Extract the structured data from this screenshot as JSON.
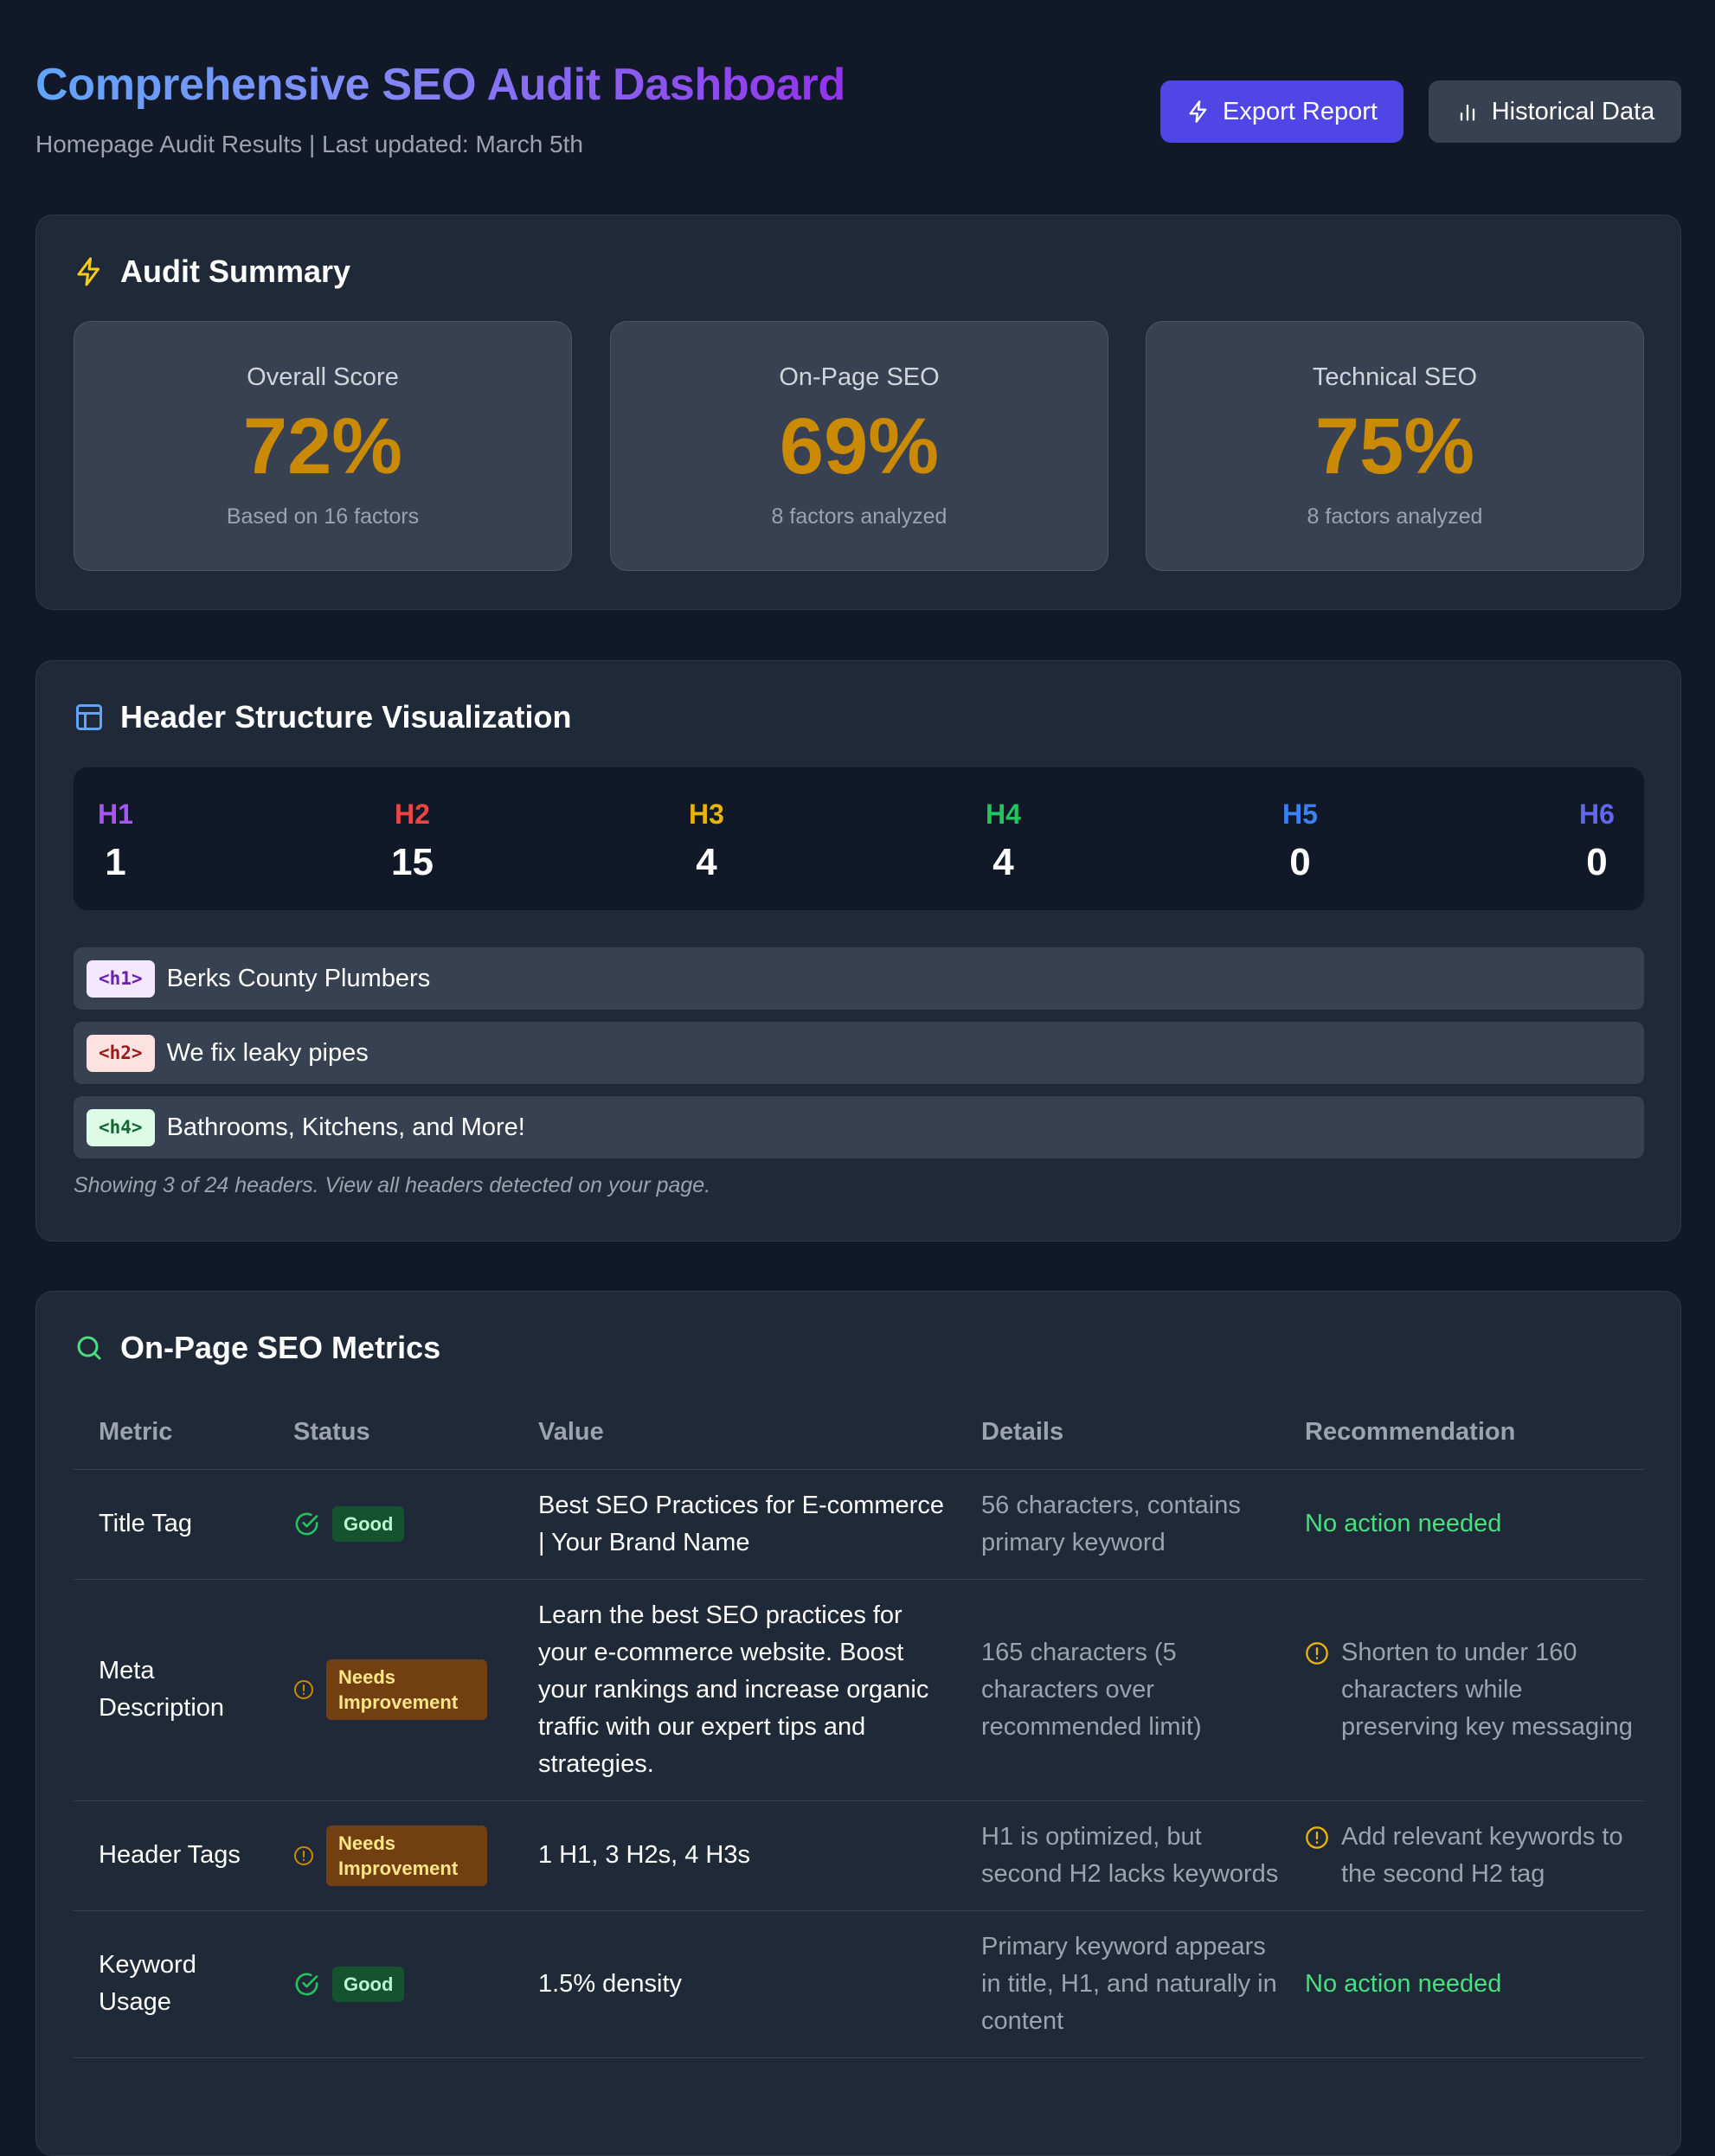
{
  "header": {
    "title": "Comprehensive SEO Audit Dashboard",
    "subtitle": "Homepage Audit Results | Last updated: March 5th",
    "buttons": {
      "export": {
        "label": "Export Report",
        "icon": "lightning-icon"
      },
      "history": {
        "label": "Historical Data",
        "icon": "bar-chart-icon"
      }
    }
  },
  "summary": {
    "title": "Audit Summary",
    "icon": "lightning-icon",
    "scores": [
      {
        "label": "Overall Score",
        "value": "72%",
        "sub": "Based on 16 factors"
      },
      {
        "label": "On-Page SEO",
        "value": "69%",
        "sub": "8 factors analyzed"
      },
      {
        "label": "Technical SEO",
        "value": "75%",
        "sub": "8 factors analyzed"
      }
    ]
  },
  "header_structure": {
    "title": "Header Structure Visualization",
    "icon": "layout-icon",
    "counts": [
      {
        "level": "H1",
        "count": "1",
        "color": "#a855f7"
      },
      {
        "level": "H2",
        "count": "15",
        "color": "#ef4444"
      },
      {
        "level": "H3",
        "count": "4",
        "color": "#eab308"
      },
      {
        "level": "H4",
        "count": "4",
        "color": "#22c55e"
      },
      {
        "level": "H5",
        "count": "0",
        "color": "#3b82f6"
      },
      {
        "level": "H6",
        "count": "0",
        "color": "#6366f1"
      }
    ],
    "headers": [
      {
        "tag": "<h1>",
        "text": "Berks County Plumbers",
        "tag_bg": "#f3e8ff",
        "tag_color": "#6b21a8"
      },
      {
        "tag": "<h2>",
        "text": "We fix leaky pipes",
        "tag_bg": "#fee2e2",
        "tag_color": "#991b1b"
      },
      {
        "tag": "<h4>",
        "text": "Bathrooms, Kitchens, and More!",
        "tag_bg": "#dcfce7",
        "tag_color": "#166534"
      }
    ],
    "note": "Showing 3 of 24 headers. View all headers detected on your page."
  },
  "metrics": {
    "title": "On-Page SEO Metrics",
    "icon": "search-icon",
    "columns": [
      "Metric",
      "Status",
      "Value",
      "Details",
      "Recommendation"
    ],
    "rows": [
      {
        "metric": "Title Tag",
        "status": "Good",
        "status_type": "good",
        "value": "Best SEO Practices for E-commerce | Your Brand Name",
        "details": "56 characters, contains primary keyword",
        "recommendation": "No action needed"
      },
      {
        "metric": "Meta Description",
        "status": "Needs Improvement",
        "status_type": "warn",
        "value": "Learn the best SEO practices for your e-commerce website. Boost your rankings and increase organic traffic with our expert tips and strategies.",
        "details": "165 characters (5 characters over recommended limit)",
        "recommendation": "Shorten to under 160 characters while preserving key messaging"
      },
      {
        "metric": "Header Tags",
        "status": "Needs Improvement",
        "status_type": "warn",
        "value": "1 H1, 3 H2s, 4 H3s",
        "details": "H1 is optimized, but second H2 lacks keywords",
        "recommendation": "Add relevant keywords to the second H2 tag"
      },
      {
        "metric": "Keyword Usage",
        "status": "Good",
        "status_type": "good",
        "value": "1.5% density",
        "details": "Primary keyword appears in title, H1, and naturally in content",
        "recommendation": "No action needed"
      }
    ]
  },
  "colors": {
    "accent": "#4f46e5",
    "score": "#ca8a04",
    "good": "#22c55e",
    "warn": "#eab308"
  }
}
